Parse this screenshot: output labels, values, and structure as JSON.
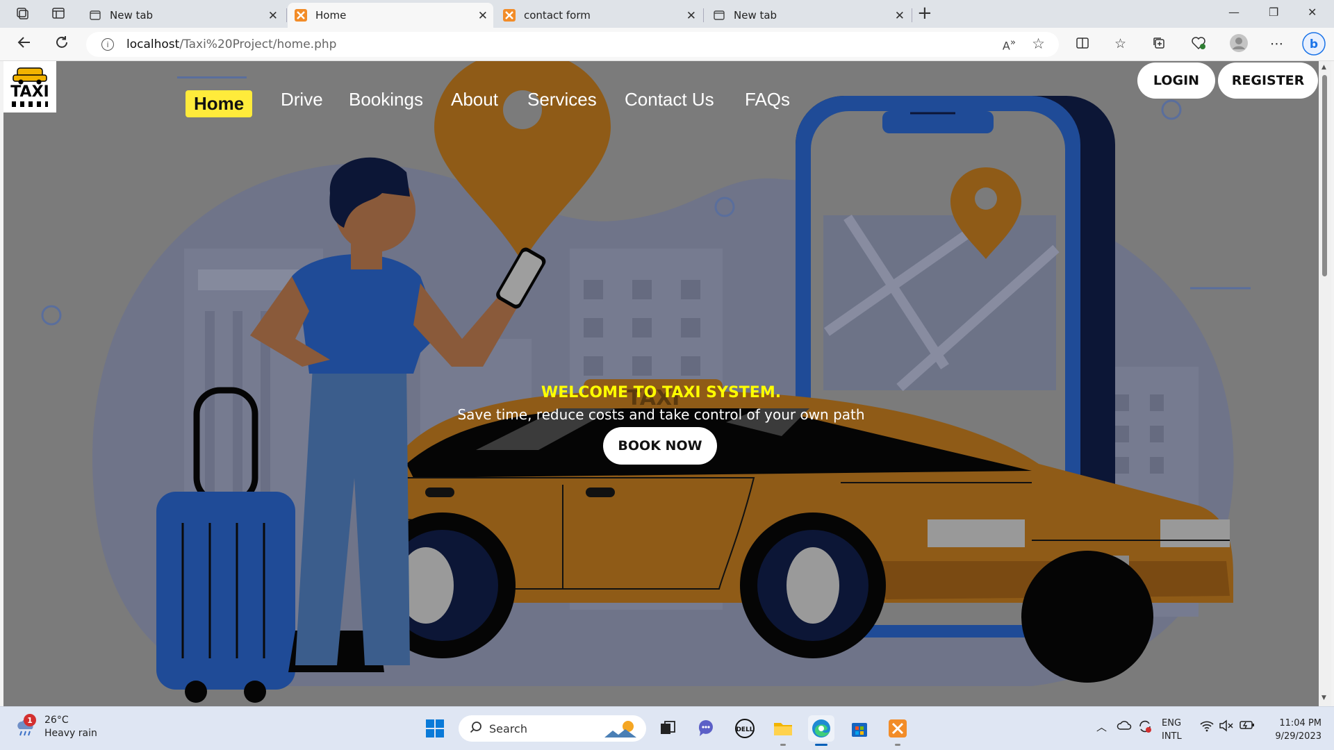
{
  "browser": {
    "tabs": [
      {
        "label": "New tab",
        "icon": "page-icon",
        "active": false
      },
      {
        "label": "Home",
        "icon": "xampp-icon",
        "active": true
      },
      {
        "label": "contact form",
        "icon": "xampp-icon",
        "active": false
      },
      {
        "label": "New tab",
        "icon": "page-icon",
        "active": false
      }
    ],
    "url_host": "localhost",
    "url_path": "/Taxi%20Project/home.php",
    "window_controls": {
      "minimize": "—",
      "restore": "❐",
      "close": "✕"
    }
  },
  "site": {
    "logo_text": "TAXI",
    "nav": [
      {
        "label": "Home",
        "active": true
      },
      {
        "label": "Drive"
      },
      {
        "label": "Bookings"
      },
      {
        "label": "About"
      },
      {
        "label": "Services"
      },
      {
        "label": "Contact Us"
      },
      {
        "label": "FAQs"
      }
    ],
    "login_label": "LOGIN",
    "register_label": "REGISTER",
    "hero": {
      "welcome": "WELCOME TO TAXI SYSTEM.",
      "tagline": "Save time, reduce costs and take control of your own path",
      "book_label": "BOOK NOW",
      "car_sign": "TAXI"
    },
    "colors": {
      "accent": "#ffeb3b",
      "welcome": "#ffff00",
      "overlay": "#7b7b7b"
    }
  },
  "taskbar": {
    "weather_badge": "1",
    "temperature": "26°C",
    "condition": "Heavy rain",
    "search_label": "Search",
    "lang_top": "ENG",
    "lang_bottom": "INTL",
    "time": "11:04 PM",
    "date": "9/29/2023"
  }
}
